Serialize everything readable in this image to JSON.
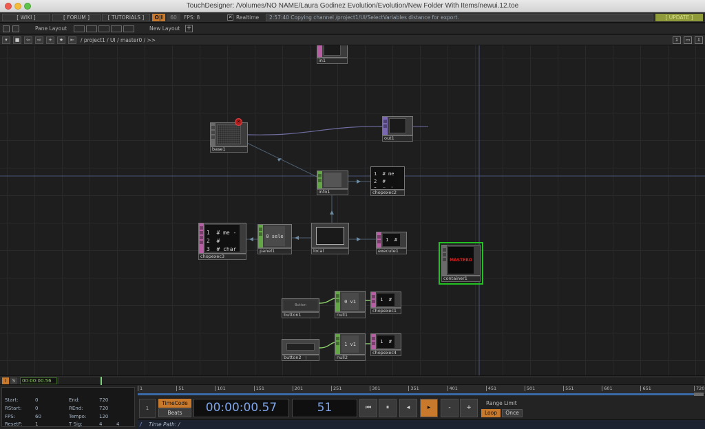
{
  "window": {
    "title": "TouchDesigner: /Volumes/NO NAME/Laura Godinez Evolution/Evolution/New Folder With Items/newui.12.toe"
  },
  "menubar": {
    "wiki": "[ WIKI ]",
    "forum": "[ FORUM ]",
    "tutorials": "[ TUTORIALS ]",
    "oi": "O|I",
    "sixty": "60",
    "fps": "FPS:  8",
    "realtime_check": "✕",
    "realtime": "Realtime",
    "status": "2:57:40 Copying channel /project1/UI/SelectVariables distance for export.",
    "update": "[ UPDATE ]"
  },
  "panebar": {
    "pane_layout": "Pane Layout",
    "new_layout": "New Layout",
    "plus": "+"
  },
  "pathbar": {
    "path": "/ project1 / UI / master0 / >>",
    "one": "1"
  },
  "nodes": {
    "in1": "in1",
    "base1": "base1",
    "out1": "out1",
    "info1": "info1",
    "chopexec2": "chopexec2",
    "chopexec2_code": "1  # me\n2  #\n3  # char",
    "chopexec3": "chopexec3",
    "chopexec3_code": "1  # me -\n2  #\n3  # char",
    "panel1": "panel1",
    "panel1_text": "0 sele",
    "local": "local",
    "execute1": "execute1",
    "execute1_text": "1  #",
    "container1": "container1",
    "container1_text": "MASTERO",
    "button1": "button1",
    "button1_text": "Button",
    "null1": "null1",
    "null1_text": "0 v1",
    "chopexec1": "chopexec1",
    "chopexec1_text": "1  #",
    "button2": "button2",
    "null2": "null2",
    "null2_text": "1 v1",
    "chopexec4": "chopexec4",
    "chopexec4_text": "1  #"
  },
  "timebar": {
    "i": "I",
    "s": "S",
    "time": "00:00:00.56"
  },
  "stats": {
    "start_label": "Start:",
    "start": "0",
    "end_label": "End:",
    "end": "720",
    "rstart_label": "RStart:",
    "rstart": "0",
    "rend_label": "REnd:",
    "rend": "720",
    "fps_label": "FPS:",
    "fps": "60",
    "tempo_label": "Tempo:",
    "tempo": "120",
    "resetf_label": "ResetF:",
    "resetf": "1",
    "tsig_label": "T Sig:",
    "tsig_a": "4",
    "tsig_b": "4"
  },
  "ruler": {
    "ticks": [
      "1",
      "51",
      "101",
      "151",
      "201",
      "251",
      "301",
      "351",
      "401",
      "451",
      "501",
      "551",
      "601",
      "651",
      "720"
    ]
  },
  "transport": {
    "one": "1",
    "timecode": "TimeCode",
    "beats": "Beats",
    "time": "00:00:00.57",
    "frame": "51",
    "to_start": "⏮",
    "pause": "⏸",
    "step_back": "◂",
    "play": "▸",
    "minus": "-",
    "plus": "+",
    "range_limit": "Range Limit",
    "loop": "Loop",
    "once": "Once",
    "time_path": "Time Path: /",
    "slash": "/"
  },
  "colors": {
    "accent": "#c9792c",
    "selected_node": "#22c222",
    "timecode": "#7fa6ec"
  }
}
